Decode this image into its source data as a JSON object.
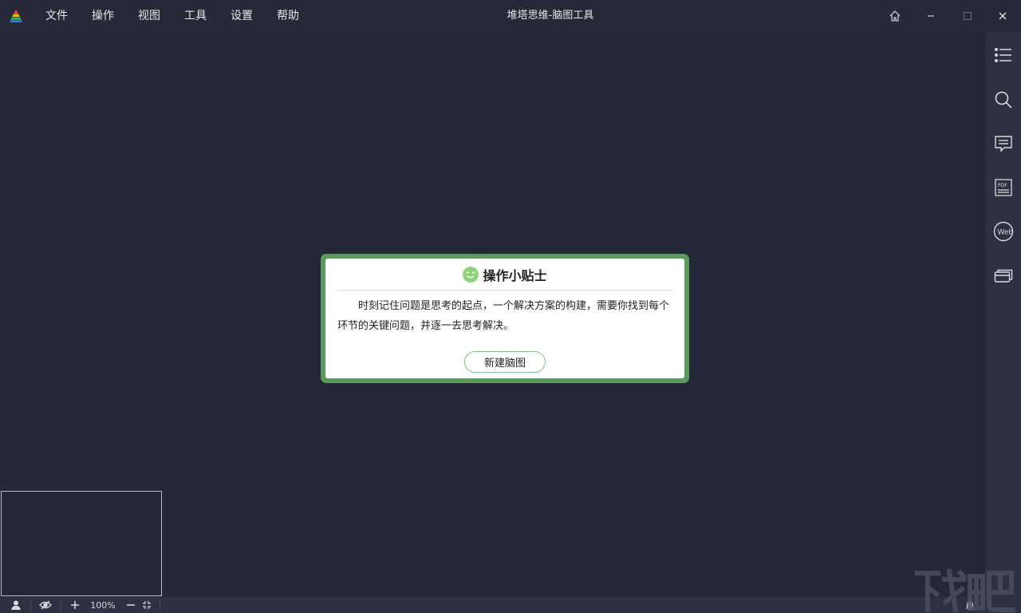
{
  "menu": {
    "items": [
      "文件",
      "操作",
      "视图",
      "工具",
      "设置",
      "帮助"
    ]
  },
  "app": {
    "title": "堆塔思维-脑图工具"
  },
  "dialog": {
    "title": "操作小贴士",
    "text": "时刻记住问题是思考的起点，一个解决方案的构建，需要你找到每个环节的关键问题，并逐一去思考解决。",
    "button_label": "新建脑图"
  },
  "statusbar": {
    "zoom": "100%"
  },
  "sidebar": {
    "icons": [
      "outline-list-icon",
      "search-icon",
      "comment-icon",
      "pdf-icon",
      "web-icon",
      "cards-icon"
    ]
  },
  "colors": {
    "background": "#262a38",
    "dialog_border": "#5a9a5c",
    "accent_green": "#7cc07e"
  }
}
